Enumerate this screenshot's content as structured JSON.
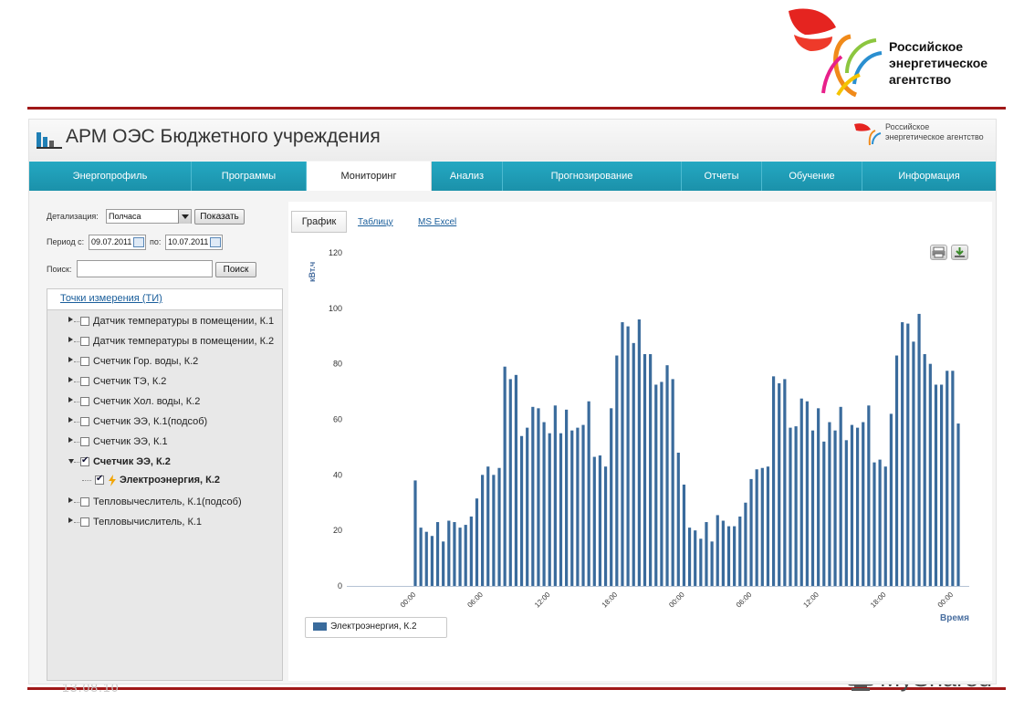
{
  "slide": {
    "org_name_lines": [
      "Российское",
      "энергетическое",
      "агентство"
    ],
    "date_watermark": "13.08.10",
    "watermark_brand": "MyShared"
  },
  "app": {
    "title": "АРМ ОЭС Бюджетного учреждения",
    "brand_lines": [
      "Российское",
      "энергетическое агентство"
    ],
    "nav": [
      {
        "label": "Энергопрофиль",
        "active": false
      },
      {
        "label": "Программы",
        "active": false
      },
      {
        "label": "Мониторинг",
        "active": true
      },
      {
        "label": "Анализ",
        "active": false
      },
      {
        "label": "Прогнозирование",
        "active": false
      },
      {
        "label": "Отчеты",
        "active": false
      },
      {
        "label": "Обучение",
        "active": false
      },
      {
        "label": "Информация",
        "active": false
      }
    ]
  },
  "filters": {
    "detail_label": "Детализация:",
    "detail_value": "Полчаса",
    "show_button": "Показать",
    "period_from_label": "Период с:",
    "period_from": "09.07.2011",
    "period_to_label": "по:",
    "period_to": "10.07.2011",
    "search_label": "Поиск:",
    "search_value": "",
    "search_button": "Поиск"
  },
  "tree": {
    "title": "Точки измерения (ТИ)",
    "items": [
      {
        "label": "Датчик температуры в помещении, К.1",
        "checked": false,
        "expanded": false,
        "level": 0
      },
      {
        "label": "Датчик температуры в помещении, К.2",
        "checked": false,
        "expanded": false,
        "level": 0
      },
      {
        "label": "Счетчик Гор. воды, К.2",
        "checked": false,
        "expanded": false,
        "level": 0
      },
      {
        "label": "Счетчик ТЭ, К.2",
        "checked": false,
        "expanded": false,
        "level": 0
      },
      {
        "label": "Счетчик Хол. воды, К.2",
        "checked": false,
        "expanded": false,
        "level": 0
      },
      {
        "label": "Счетчик ЭЭ, К.1(подсоб)",
        "checked": false,
        "expanded": false,
        "level": 0
      },
      {
        "label": "Счетчик ЭЭ, К.1",
        "checked": false,
        "expanded": false,
        "level": 0
      },
      {
        "label": "Счетчик ЭЭ, К.2",
        "checked": true,
        "expanded": true,
        "level": 0,
        "bold": true
      },
      {
        "label": "Электроэнергия, К.2",
        "checked": true,
        "expanded": false,
        "level": 1,
        "bold": true,
        "icon": "lightning-icon"
      },
      {
        "label": "Тепловычеслитель, К.1(подсоб)",
        "checked": false,
        "expanded": false,
        "level": 0
      },
      {
        "label": "Тепловычислитель, К.1",
        "checked": false,
        "expanded": false,
        "level": 0
      }
    ]
  },
  "view_tabs": {
    "chart": "График",
    "table": "Таблицу",
    "excel": "MS Excel"
  },
  "chart_data": {
    "type": "bar",
    "ylabel": "кВт.ч",
    "xlabel": "Время",
    "ylim": [
      0,
      120
    ],
    "y_ticks": [
      0,
      20,
      40,
      60,
      80,
      100,
      120
    ],
    "x_tick_labels": [
      "00:00",
      "06:00",
      "12:00",
      "18:00",
      "00:00",
      "06:00",
      "12:00",
      "18:00",
      "00:00"
    ],
    "grid": false,
    "legend_position": "bottom-left",
    "series": [
      {
        "name": "Электроэнергия, К.2",
        "color": "#3a6b9c",
        "values": [
          38,
          21,
          19.5,
          18,
          23,
          16,
          23.5,
          23,
          21,
          22,
          25,
          31.5,
          40,
          43,
          40,
          42.5,
          79,
          74.5,
          76,
          54,
          57,
          64.5,
          64,
          59,
          55,
          65,
          55,
          63.5,
          56,
          57,
          58,
          66.5,
          46.5,
          47,
          43,
          64,
          83,
          95,
          93.5,
          87.5,
          96,
          83.5,
          83.5,
          72.5,
          73.5,
          79.5,
          74.5,
          48,
          36.5,
          21,
          20,
          17,
          23,
          16,
          25.5,
          23.5,
          21.5,
          21.5,
          25,
          30,
          38.5,
          42,
          42.5,
          43,
          75.5,
          73,
          74.5,
          57,
          57.5,
          67.5,
          66.5,
          56,
          64,
          52,
          59,
          56,
          64.5,
          52.5,
          58,
          57,
          59,
          65,
          44.5,
          45.5,
          43,
          62,
          83,
          95,
          94.5,
          88,
          98,
          83.5,
          80,
          72.5,
          72.5,
          77.5,
          77.5,
          58.5
        ]
      }
    ]
  },
  "icons": {
    "print": "printer-icon",
    "export": "download-icon",
    "calendar": "calendar-icon"
  }
}
